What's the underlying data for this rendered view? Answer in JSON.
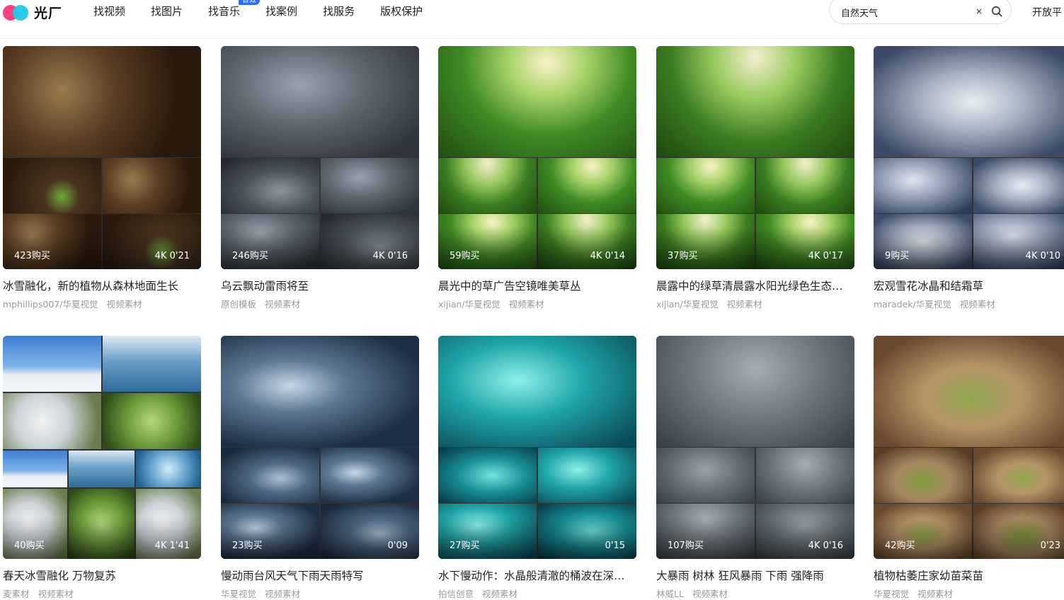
{
  "header": {
    "logo_text": "光厂",
    "nav": [
      {
        "label": "找视频"
      },
      {
        "label": "找图片"
      },
      {
        "label": "找音乐",
        "badge": "音效"
      },
      {
        "label": "找案例"
      },
      {
        "label": "找服务"
      },
      {
        "label": "版权保护"
      }
    ],
    "search": {
      "value": "自然天气",
      "clear_glyph": "×"
    },
    "open_link": "开放平"
  },
  "cards": [
    {
      "title": "冰雪融化，新的植物从森林地面生长",
      "author": "mphillips007/华夏视觉",
      "category": "视频素材",
      "purchases": "423购买",
      "meta": "4K  0'21",
      "palette": [
        "t-soil",
        "t-soil2"
      ]
    },
    {
      "title": "乌云飘动雷雨将至",
      "author": "原创模板",
      "category": "视频素材",
      "purchases": "246购买",
      "meta": "4K  0'16",
      "palette": [
        "t-cloud",
        "t-cloud2"
      ]
    },
    {
      "title": "晨光中的草广告空镜唯美草丛",
      "author": "xijian/华夏视觉",
      "category": "视频素材",
      "purchases": "59购买",
      "meta": "4K  0'14",
      "palette": [
        "t-grass",
        "t-grass2"
      ]
    },
    {
      "title": "晨露中的绿草清晨露水阳光绿色生态…",
      "author": "xijian/华夏视觉",
      "category": "视频素材",
      "purchases": "37购买",
      "meta": "4K  0'17",
      "palette": [
        "t-grass2",
        "t-grass"
      ]
    },
    {
      "title": "宏观雪花冰晶和结霜草",
      "author": "maradek/华夏视觉",
      "category": "视频素材",
      "purchases": "9购买",
      "meta": "4K  0'10",
      "palette": [
        "t-frost",
        "t-frost2"
      ]
    },
    {
      "title": "春天冰雪融化 万物复苏",
      "author": "麦素材",
      "category": "视频素材",
      "purchases": "40购买",
      "meta": "4K  1'41",
      "palette": [
        "t-tree",
        "t-ice",
        "t-snow",
        "t-leaf",
        "t-icebl"
      ],
      "collage": true
    },
    {
      "title": "慢动雨台风天气下雨天雨特写",
      "author": "华夏视觉",
      "category": "视频素材",
      "purchases": "23购买",
      "meta": "0'09",
      "palette": [
        "t-storm",
        "t-storm2"
      ]
    },
    {
      "title": "水下慢动作：水晶般清澈的桶波在深…",
      "author": "拍信创意",
      "category": "视频素材",
      "purchases": "27购买",
      "meta": "0'15",
      "palette": [
        "t-water",
        "t-water2"
      ]
    },
    {
      "title": "大暴雨 树林 狂风暴雨 下雨 强降雨",
      "author": "林威LL",
      "category": "视频素材",
      "purchases": "107购买",
      "meta": "4K  0'16",
      "palette": [
        "t-fog",
        "t-fog2"
      ]
    },
    {
      "title": "植物枯萎庄家幼苗菜苗",
      "author": "华夏视觉",
      "category": "视频素材",
      "purchases": "42购买",
      "meta": "0'23",
      "palette": [
        "t-sprout",
        "t-sprout2"
      ]
    }
  ]
}
